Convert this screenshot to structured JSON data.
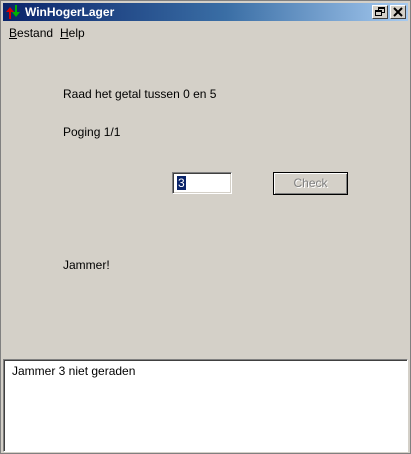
{
  "window": {
    "title": "WinHogerLager"
  },
  "menu": {
    "items": [
      {
        "accel": "B",
        "rest": "estand"
      },
      {
        "accel": "H",
        "rest": "elp"
      }
    ]
  },
  "game": {
    "prompt": "Raad het getal tussen 0 en 5",
    "attempt": "Poging 1/1",
    "guess_value": "3",
    "check_label": "Check",
    "result": "Jammer!"
  },
  "log": {
    "lines": [
      "Jammer 3 niet geraden"
    ]
  },
  "colors": {
    "titlebar_start": "#0a246a",
    "titlebar_end": "#a6caf0",
    "face": "#d4d0c8"
  },
  "icons": {
    "app": "up-down-arrows-icon",
    "restore": "restore-icon",
    "close": "close-icon"
  }
}
